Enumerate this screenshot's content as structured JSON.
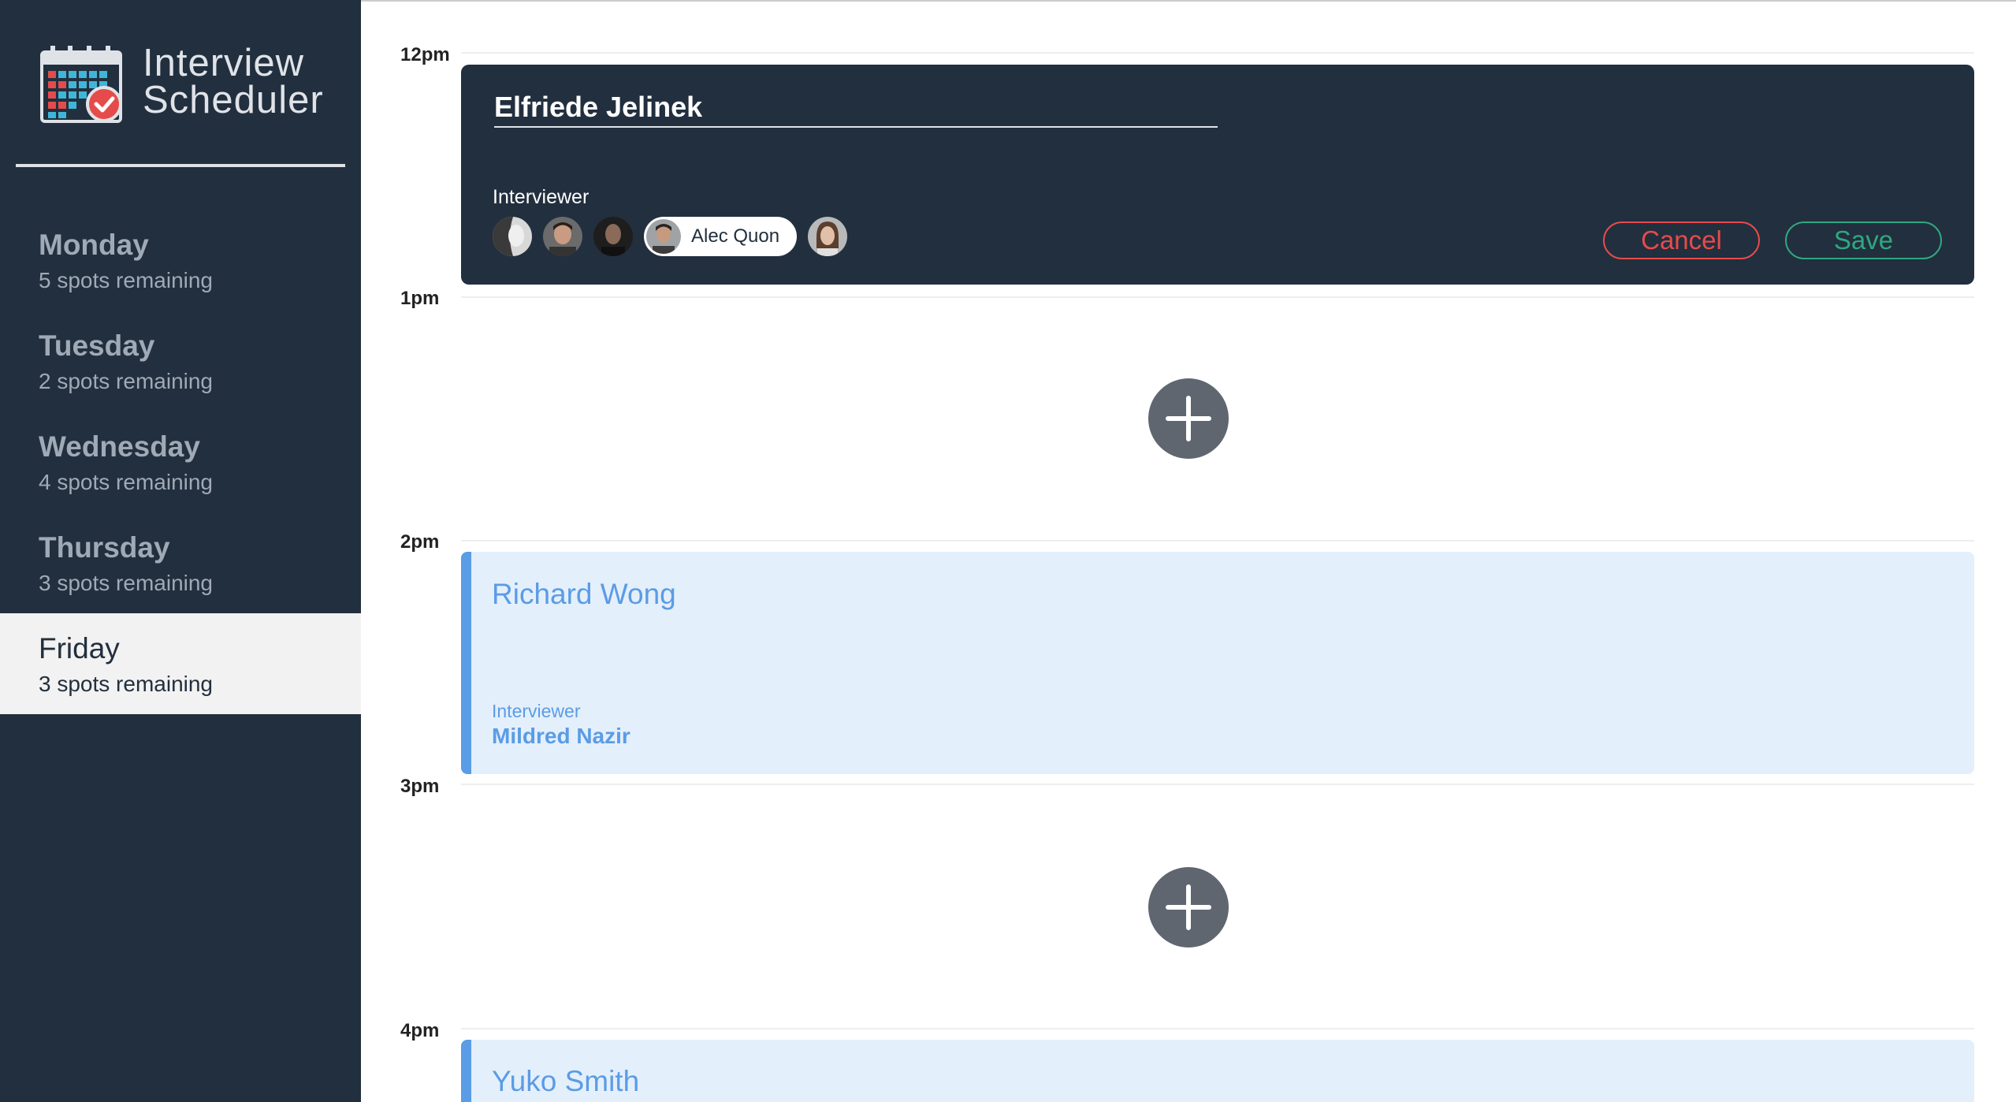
{
  "app": {
    "title_line1": "Interview",
    "title_line2": "Scheduler"
  },
  "sidebar": {
    "days": [
      {
        "name": "Monday",
        "spots": "5 spots remaining",
        "selected": false
      },
      {
        "name": "Tuesday",
        "spots": "2 spots remaining",
        "selected": false
      },
      {
        "name": "Wednesday",
        "spots": "4 spots remaining",
        "selected": false
      },
      {
        "name": "Thursday",
        "spots": "3 spots remaining",
        "selected": false
      },
      {
        "name": "Friday",
        "spots": "3 spots remaining",
        "selected": true
      }
    ]
  },
  "schedule": {
    "hours": [
      "12pm",
      "1pm",
      "2pm",
      "3pm",
      "4pm"
    ],
    "form": {
      "student_name": "Elfriede Jelinek",
      "interviewer_label": "Interviewer",
      "selected_interviewer": "Alec Quon",
      "cancel_label": "Cancel",
      "save_label": "Save"
    },
    "booked": [
      {
        "student": "Richard Wong",
        "interviewer_label": "Interviewer",
        "interviewer": "Mildred Nazir"
      },
      {
        "student": "Yuko Smith"
      }
    ]
  },
  "colors": {
    "sidebar_bg": "#222f3e",
    "selected_day_bg": "#f2f2f2",
    "booked_bg": "#e4effc",
    "booked_accent": "#5a9ce5",
    "cancel": "#e64b4b",
    "save": "#2fa880",
    "add_button": "#5f6670"
  },
  "icons": [
    "calendar-check-icon",
    "plus-icon"
  ]
}
